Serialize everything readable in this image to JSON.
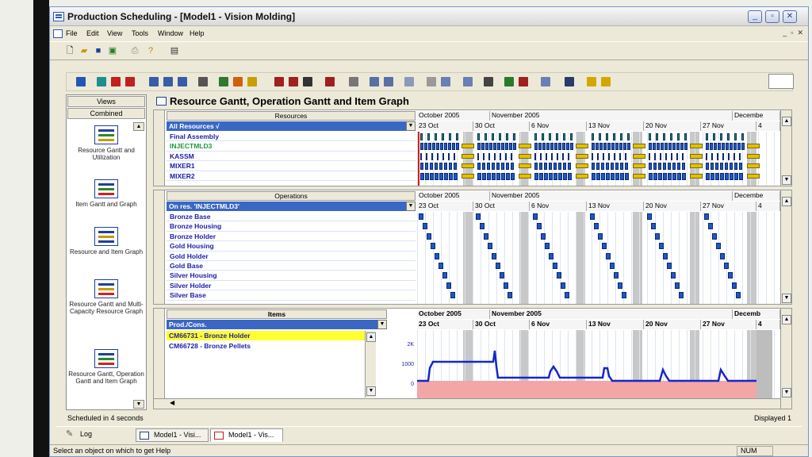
{
  "window": {
    "title": "Production Scheduling - [Model1 - Vision Molding]"
  },
  "menu": [
    "File",
    "Edit",
    "View",
    "Tools",
    "Window",
    "Help"
  ],
  "left_panel": {
    "tab_views": "Views",
    "tab_combined": "Combined",
    "items": [
      "Resource Gantt and Utilization",
      "Item Gantt and Graph",
      "Resource and Item Graph",
      "Resource Gantt and Multi-Capacity Resource Graph",
      "Resource Gantt, Operation Gantt and Item Graph"
    ]
  },
  "main": {
    "title": "Resource Gantt, Operation Gantt and Item Graph"
  },
  "timeline": {
    "months": [
      "October 2005",
      "November 2005",
      "Decembe"
    ],
    "weeks": [
      "23 Oct",
      "30 Oct",
      "6 Nov",
      "13 Nov",
      "20 Nov",
      "27 Nov",
      "4"
    ]
  },
  "resources": {
    "header": "Resources",
    "filter": "All Resources √",
    "rows": [
      "Final Assembly",
      "INJECTMLD3",
      "KASSM",
      "MIXER1",
      "MIXER2"
    ]
  },
  "operations": {
    "header": "Operations",
    "filter": "On res. 'INJECTMLD3'",
    "rows": [
      "Bronze Base",
      "Bronze Housing",
      "Bronze Holder",
      "Gold Housing",
      "Gold Holder",
      "Gold Base",
      "Silver Housing",
      "Silver Holder",
      "Silver Base"
    ]
  },
  "items": {
    "header": "Items",
    "filter": "Prod./Cons.",
    "months": [
      "October 2005",
      "November 2005",
      "Decemb"
    ],
    "rows": [
      "CM66731 - Bronze Holder",
      "CM66728 - Bronze Pellets"
    ],
    "y_ticks": [
      "2K",
      "1000",
      "0"
    ]
  },
  "status": {
    "scheduled": "Scheduled in 4 seconds",
    "displayed": "Displayed 1",
    "help": "Select an object on which to get Help",
    "num": "NUM"
  },
  "tabs": [
    "Log",
    "Model1 - Visi...",
    "Model1 - Vis..."
  ],
  "colors": {
    "accent": "#3a67c4",
    "bar_blue": "#1f56c8",
    "bar_gold": "#e2c100",
    "bar_green": "#1e9a3a",
    "area_pink": "#f2a6a6",
    "line": "#1428c8",
    "highlight": "#ffff33"
  }
}
